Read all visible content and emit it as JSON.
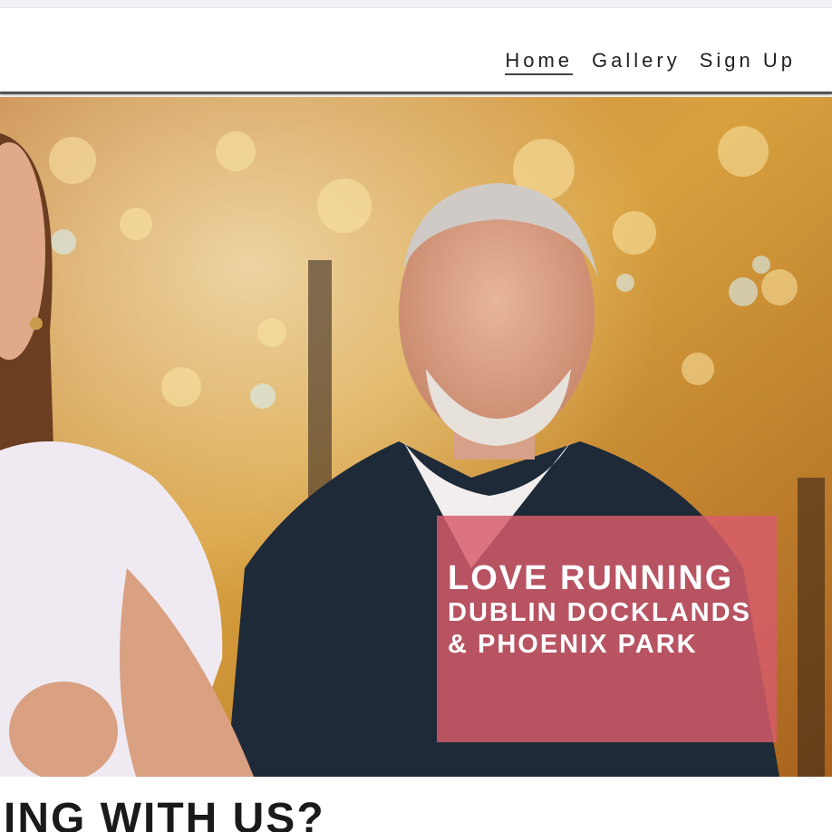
{
  "nav": {
    "items": [
      {
        "label": "Home",
        "active": true
      },
      {
        "label": "Gallery",
        "active": false
      },
      {
        "label": "Sign Up",
        "active": false
      }
    ]
  },
  "hero": {
    "image_description_icon": "runners-photo",
    "overlay": {
      "title": "LOVE RUNNING",
      "line1": "DUBLIN DOCKLANDS",
      "line2": "& PHOENIX PARK"
    }
  },
  "section": {
    "heading_visible_fragment": "ING WITH US?"
  },
  "colors": {
    "overlay": "#d65c6a",
    "header_rule": "#555555",
    "nav_text": "#222222"
  }
}
